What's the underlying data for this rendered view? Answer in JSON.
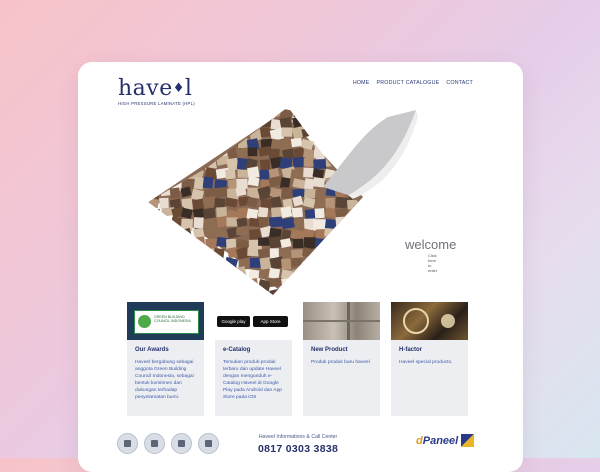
{
  "logo": {
    "text_main": "have",
    "text_end": "l",
    "tagline": "HIGH PRESSURE LAMINATE (HPL)"
  },
  "nav": [
    "HOME",
    "PRODUCT CATALOGUE",
    "CONTACT"
  ],
  "hero": {
    "welcome": "welcome",
    "sub": "Click here to enter"
  },
  "tiles": [
    {
      "title": "Our Awards",
      "desc": "Haveel bergabung sebagai anggota Green Building Council Indonesia, sebagai bentuk komitmen dan dukungan terhadap penyelamatan bumi.",
      "img_label": "GREEN BUILDING COUNCIL INDONESIA"
    },
    {
      "title": "e-Catalog",
      "desc": "Temukan produk-produk terbaru dan update Haveel dengan mengunduh e-Catalog Haveel di Google Play pada Android dan App Store pada iOS",
      "store1": "Google play",
      "store2": "App Store"
    },
    {
      "title": "New Product",
      "desc": "Produk produk baru haveel"
    },
    {
      "title": "H-factor",
      "desc": "Haveel special products."
    }
  ],
  "footer": {
    "call_label": "Haveel Informations & Call Center",
    "phone": "0817 0303 3838",
    "brand_prefix": "d",
    "brand": "Paneel"
  },
  "colors": {
    "navy": "#25306a",
    "link": "#3f5aa8",
    "tile_bg": "#eceef2"
  }
}
